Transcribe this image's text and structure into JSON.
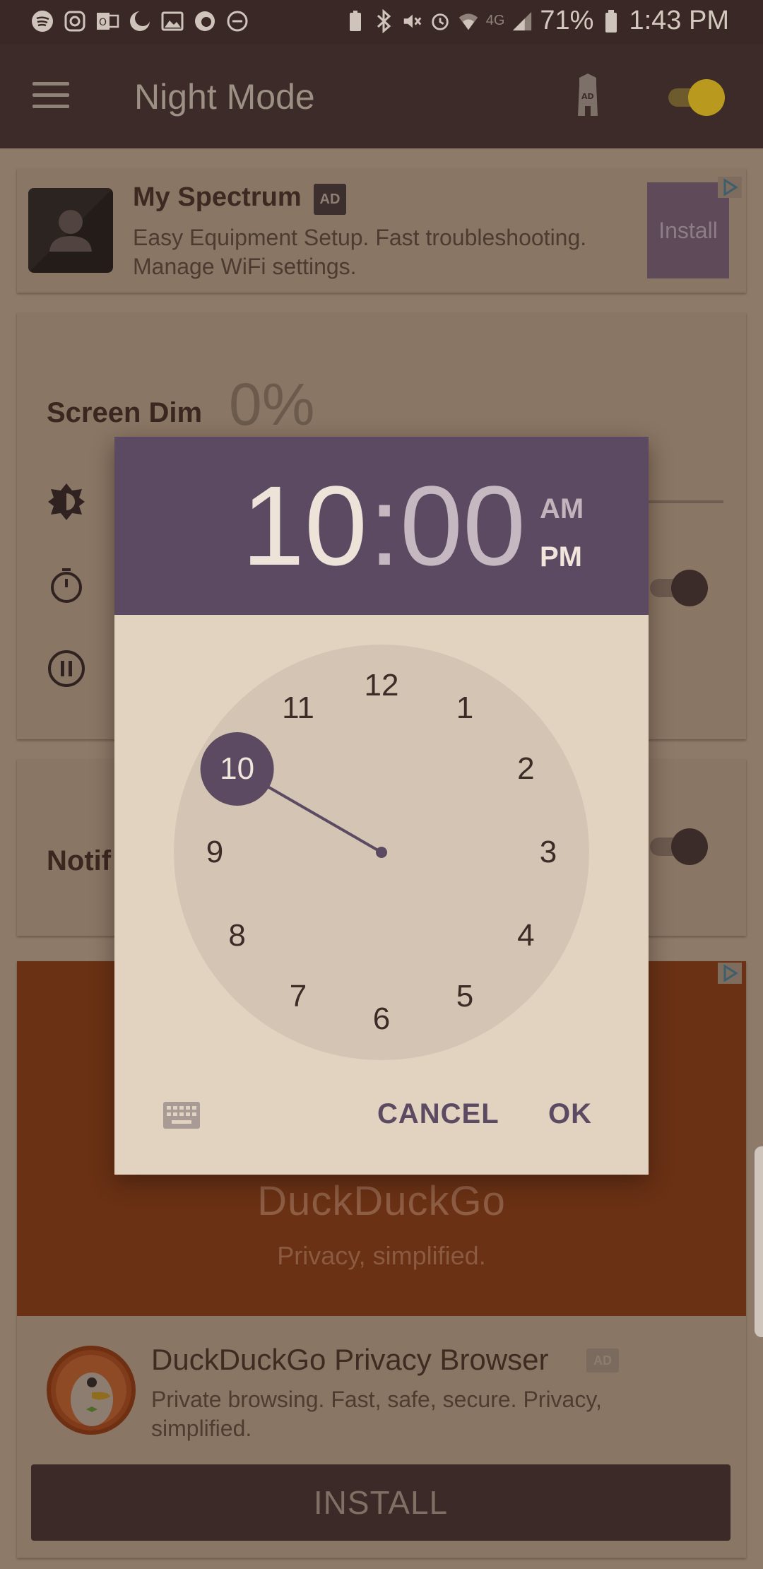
{
  "status_bar": {
    "battery_pct": "71%",
    "time": "1:43 PM",
    "network": "4G"
  },
  "app_bar": {
    "title": "Night Mode",
    "menu_icon": "hamburger-icon",
    "ad_icon": "ad-tower-icon",
    "night_mode_enabled": true
  },
  "ad_top": {
    "name": "My Spectrum",
    "badge": "AD",
    "description": "Easy Equipment Setup. Fast troubleshooting. Manage WiFi settings.",
    "install_label": "Install"
  },
  "screen_dim": {
    "label": "Screen Dim",
    "value": "0%"
  },
  "notification": {
    "label_partial": "Notif"
  },
  "ddg_ad": {
    "banner_title": "DuckDuckGo",
    "banner_subtitle": "Privacy, simplified.",
    "app_name": "DuckDuckGo Privacy Browser",
    "badge": "AD",
    "description": "Private browsing. Fast, safe, secure. Privacy, simplified.",
    "install_label": "INSTALL"
  },
  "time_picker": {
    "hours": "10",
    "colon": ":",
    "minutes": "00",
    "am_label": "AM",
    "pm_label": "PM",
    "selected_period": "PM",
    "selected_hour": 10,
    "clock_numbers": [
      "12",
      "1",
      "2",
      "3",
      "4",
      "5",
      "6",
      "7",
      "8",
      "9",
      "10",
      "11"
    ],
    "cancel_label": "CANCEL",
    "ok_label": "OK"
  },
  "colors": {
    "dialog_header": "#5b4a61",
    "dialog_body": "#e2d3c1",
    "clock_face": "#d4c4b3",
    "accent_yellow": "#b99a1e",
    "ddg_orange": "#6a3114"
  }
}
